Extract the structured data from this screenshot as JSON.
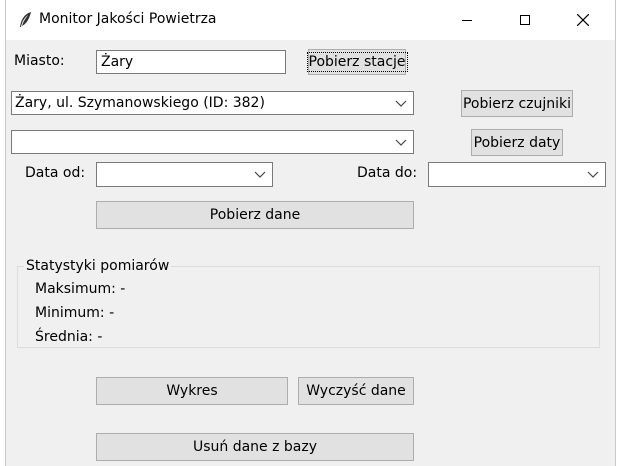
{
  "window": {
    "title": "Monitor Jakości Powietrza"
  },
  "city": {
    "label": "Miasto:",
    "value": "Żary"
  },
  "buttons": {
    "fetch_stations": "Pobierz stacje",
    "fetch_sensors": "Pobierz czujniki",
    "fetch_dates": "Pobierz daty",
    "fetch_data": "Pobierz dane",
    "chart": "Wykres",
    "clear_data": "Wyczyść dane",
    "delete_db": "Usuń dane z bazy"
  },
  "station_select": {
    "value": "Żary, ul. Szymanowskiego  (ID: 382)"
  },
  "sensor_select": {
    "value": ""
  },
  "date_from": {
    "label": "Data od:",
    "value": ""
  },
  "date_to": {
    "label": "Data do:",
    "value": ""
  },
  "stats": {
    "title": "Statystyki pomiarów",
    "max_label": "Maksimum:",
    "max_value": "-",
    "min_label": "Minimum:",
    "min_value": "-",
    "avg_label": "Średnia:",
    "avg_value": "-"
  },
  "colors": {
    "window_bg": "#f0f0f0",
    "button_bg": "#e1e1e1",
    "titlebar_bg": "#ffffff"
  }
}
